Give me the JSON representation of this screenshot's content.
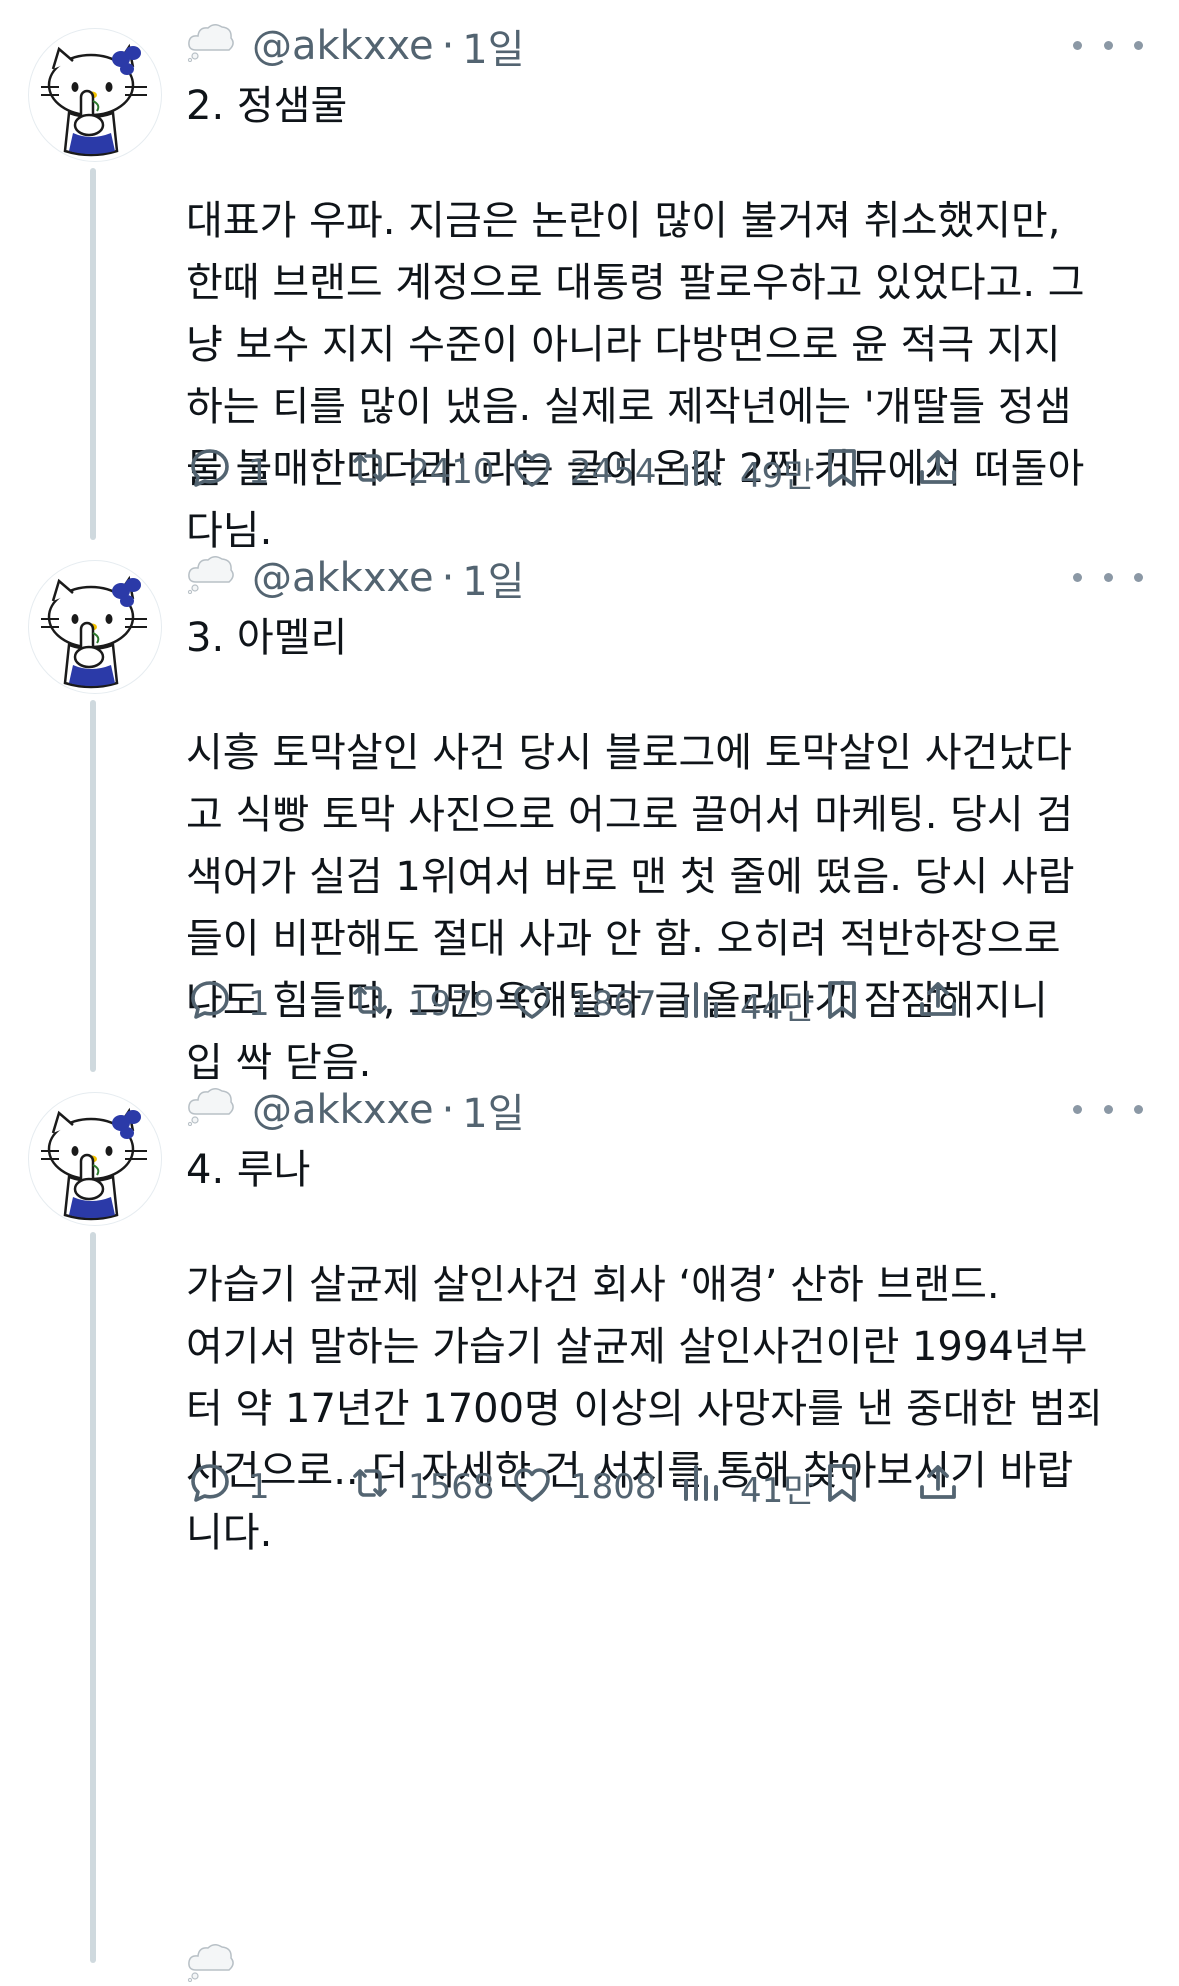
{
  "tweets": [
    {
      "handle": "@akkxxe",
      "separator": "·",
      "time": "1일",
      "title": "2. 정샘물",
      "lines": [
        "대표가 우파. 지금은 논란이 많이 불거져 취소했지만,",
        "한때 브랜드 계정으로 대통령 팔로우하고 있었다고. 그",
        "냥 보수 지지 수준이 아니라 다방면으로 윤 적극 지지",
        "하는 티를 많이 냈음. 실제로 제작년에는 '개딸들 정샘",
        "물 불매한다더라' 라는 글이 온갖 2찍 커뮤에서 떠돌아",
        "다님."
      ],
      "replies": "1",
      "retweets": "2410",
      "likes": "2454",
      "views": "49만"
    },
    {
      "handle": "@akkxxe",
      "separator": "·",
      "time": "1일",
      "title": "3. 아멜리",
      "lines": [
        "시흥 토막살인 사건 당시 블로그에 토막살인 사건났다",
        "고 식빵 토막 사진으로 어그로 끌어서 마케팅. 당시 검",
        "색어가 실검 1위여서 바로 맨 첫 줄에 떴음. 당시 사람",
        "들이 비판해도 절대 사과 안 함. 오히려 적반하장으로",
        "나도 힘들다, 그만 욕해달라 글 올리다가 잠잠해지니",
        "입 싹 닫음."
      ],
      "replies": "1",
      "retweets": "1979",
      "likes": "1867",
      "views": "44만"
    },
    {
      "handle": "@akkxxe",
      "separator": "·",
      "time": "1일",
      "title": "4. 루나",
      "lines": [
        "가습기 살균제 살인사건 회사 ‘애경’ 산하 브랜드.",
        "여기서 말하는 가습기 살균제 살인사건이란 1994년부",
        "터 약 17년간 1700명 이상의 사망자를 낸 중대한 범죄",
        "사건으로.. 더 자세한 건 서치를 통해 찾아보시기 바랍",
        "니다."
      ],
      "replies": "1",
      "retweets": "1568",
      "likes": "1808",
      "views": "41만"
    }
  ],
  "icons": {
    "reply": "reply-icon",
    "retweet": "retweet-icon",
    "like": "heart-icon",
    "views": "views-icon",
    "bookmark": "bookmark-icon",
    "share": "share-icon",
    "more": "more-icon"
  },
  "colors": {
    "text": "#0f1419",
    "muted": "#536471",
    "thread_line": "#cfd9de"
  }
}
